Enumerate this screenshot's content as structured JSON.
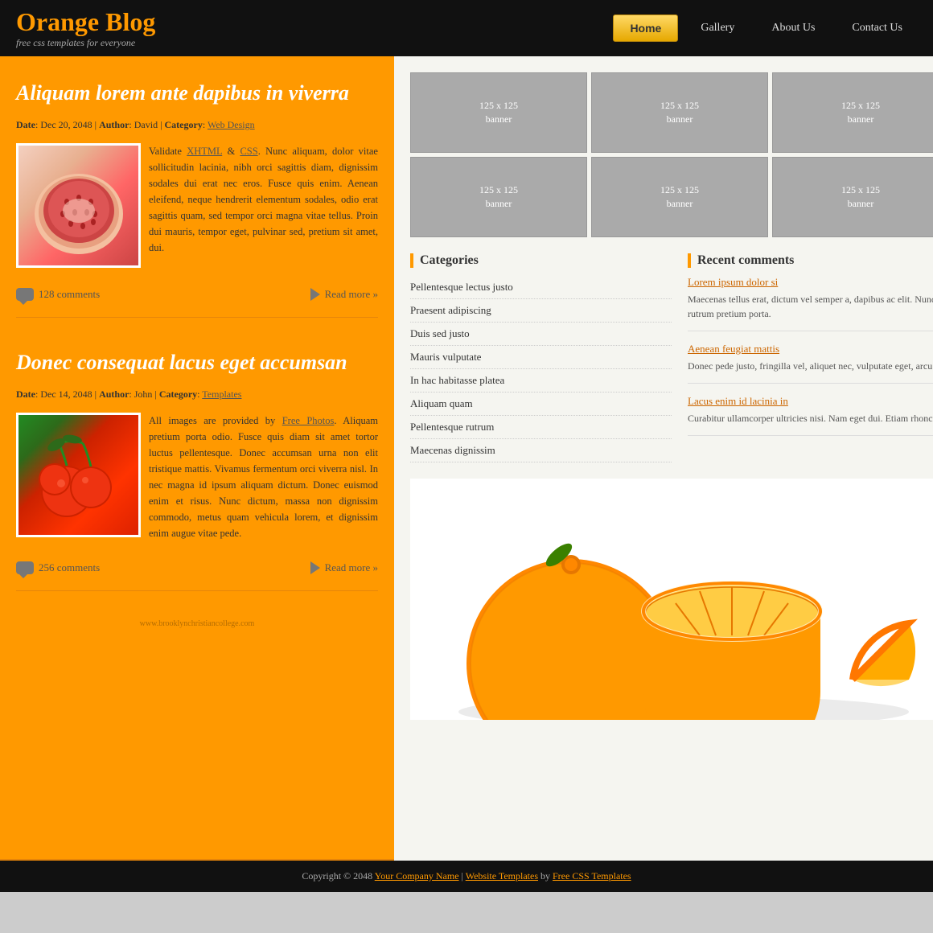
{
  "header": {
    "logo_title": "Orange Blog",
    "logo_subtitle": "free css templates for everyone",
    "nav": {
      "home_label": "Home",
      "gallery_label": "Gallery",
      "about_label": "About Us",
      "contact_label": "Contact Us"
    }
  },
  "posts": [
    {
      "title": "Aliquam lorem ante dapibus in viverra",
      "date": "Dec 20, 2048",
      "author": "David",
      "category": "Web Design",
      "text": "Validate XHTML & CSS. Nunc aliquam, dolor vitae sollicitudin lacinia, nibh orci sagittis diam, dignissim sodales dui erat nec eros. Fusce quis enim. Aenean eleifend, neque hendrerit elementum sodales, odio erat sagittis quam, sed tempor orci magna vitae tellus. Proin dui mauris, tempor eget, pulvinar sed, pretium sit amet, dui.",
      "comments": "128 comments",
      "read_more": "Read more »"
    },
    {
      "title": "Donec consequat lacus eget accumsan",
      "date": "Dec 14, 2048",
      "author": "John",
      "category": "Templates",
      "text": "All images are provided by Free Photos. Aliquam pretium porta odio. Fusce quis diam sit amet tortor luctus pellentesque. Donec accumsan urna non elit tristique mattis. Vivamus fermentum orci viverra nisl. In nec magna id ipsum aliquam dictum. Donec euismod enim et risus. Nunc dictum, massa non dignissim commodo, metus quam vehicula lorem, et dignissim enim augue vitae pede.",
      "comments": "256 comments",
      "read_more": "Read more »"
    }
  ],
  "sidebar": {
    "banners": [
      {
        "label": "125 x 125\nbanner"
      },
      {
        "label": "125 x 125\nbanner"
      },
      {
        "label": "125 x 125\nbanner"
      },
      {
        "label": "125 x 125\nbanner"
      },
      {
        "label": "125 x 125\nbanner"
      },
      {
        "label": "125 x 125\nbanner"
      }
    ],
    "categories_title": "Categories",
    "categories": [
      "Pellentesque lectus justo",
      "Praesent adipiscing",
      "Duis sed justo",
      "Mauris vulputate",
      "In hac habitasse platea",
      "Aliquam quam",
      "Pellentesque rutrum",
      "Maecenas dignissim"
    ],
    "comments_title": "Recent comments",
    "comments": [
      {
        "link": "Lorem ipsum dolor si",
        "text": "Maecenas tellus erat, dictum vel semper a, dapibus ac elit. Nunc rutrum pretium porta."
      },
      {
        "link": "Aenean feugiat mattis",
        "text": "Donec pede justo, fringilla vel, aliquet nec, vulputate eget, arcu."
      },
      {
        "link": "Lacus enim id lacinia in",
        "text": "Curabitur ullamcorper ultricies nisi. Nam eget dui. Etiam rhoncus."
      }
    ]
  },
  "footer": {
    "text": "Copyright © 2048",
    "company": "Your Company Name",
    "templates_label": "Website Templates",
    "by": "by",
    "css_templates": "Free CSS Templates"
  },
  "watermark": "www.brooklynchristiancollege.com"
}
